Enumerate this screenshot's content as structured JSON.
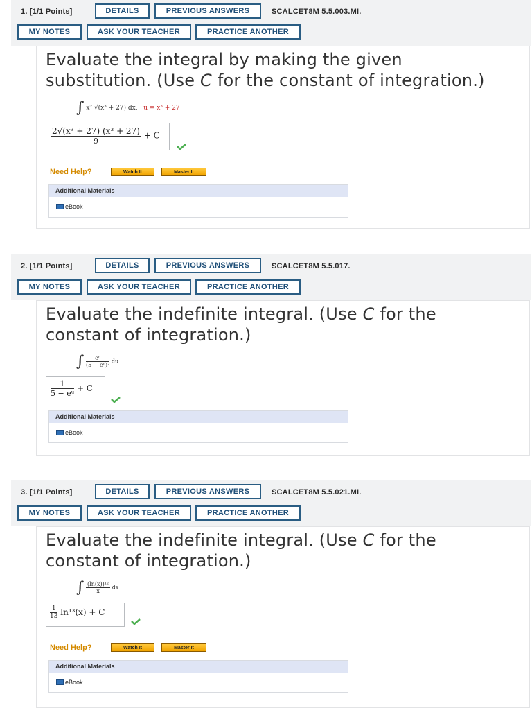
{
  "questions": [
    {
      "number": "1.",
      "points": "[1/1 Points]",
      "buttons": {
        "details": "DETAILS",
        "previous": "PREVIOUS ANSWERS",
        "notes": "MY NOTES",
        "ask": "ASK YOUR TEACHER",
        "practice": "PRACTICE ANOTHER"
      },
      "code": "SCALCET8M 5.5.003.MI.",
      "prompt_a": "Evaluate the integral by making the given",
      "prompt_b": "substitution. (Use ",
      "prompt_c": "C",
      "prompt_d": " for the constant of integration.)",
      "integral": {
        "integrand": "x² √(x³ + 27) dx,",
        "sub": "u = x³ + 27"
      },
      "answer": {
        "numerator": "2√(x³ + 27) (x³ + 27)",
        "denominator": "9",
        "tail": "+ C"
      },
      "help": {
        "label": "Need Help?",
        "watch": "Watch It",
        "master": "Master It"
      },
      "materials": {
        "title": "Additional Materials",
        "ebook": "eBook"
      }
    },
    {
      "number": "2.",
      "points": "[1/1 Points]",
      "buttons": {
        "details": "DETAILS",
        "previous": "PREVIOUS ANSWERS",
        "notes": "MY NOTES",
        "ask": "ASK YOUR TEACHER",
        "practice": "PRACTICE ANOTHER"
      },
      "code": "SCALCET8M 5.5.017.",
      "prompt_a": "Evaluate the indefinite integral. (Use ",
      "prompt_c": "C",
      "prompt_d": " for the",
      "prompt_b": "constant of integration.)",
      "integral": {
        "numerator": "eᵘ",
        "denominator": "(5 − eᵘ)²",
        "dvar": "du"
      },
      "answer": {
        "numerator": "1",
        "denominator": "5 − eᵘ",
        "tail": "+ C"
      },
      "materials": {
        "title": "Additional Materials",
        "ebook": "eBook"
      }
    },
    {
      "number": "3.",
      "points": "[1/1 Points]",
      "buttons": {
        "details": "DETAILS",
        "previous": "PREVIOUS ANSWERS",
        "notes": "MY NOTES",
        "ask": "ASK YOUR TEACHER",
        "practice": "PRACTICE ANOTHER"
      },
      "code": "SCALCET8M 5.5.021.MI.",
      "prompt_a": "Evaluate the indefinite integral. (Use ",
      "prompt_c": "C",
      "prompt_d": " for the",
      "prompt_b": "constant of integration.)",
      "integral": {
        "numerator": "(ln(x))¹²",
        "denominator": "x",
        "dvar": "dx"
      },
      "answer": {
        "frac_num": "1",
        "frac_den": "13",
        "body": "ln¹³(x) + C"
      },
      "help": {
        "label": "Need Help?",
        "watch": "Watch It",
        "master": "Master It"
      },
      "materials": {
        "title": "Additional Materials",
        "ebook": "eBook"
      }
    }
  ],
  "colors": {
    "button_border": "#2a5d83",
    "help": "#d48a00",
    "check": "#4caf50",
    "highlight_red": "#c62828"
  }
}
